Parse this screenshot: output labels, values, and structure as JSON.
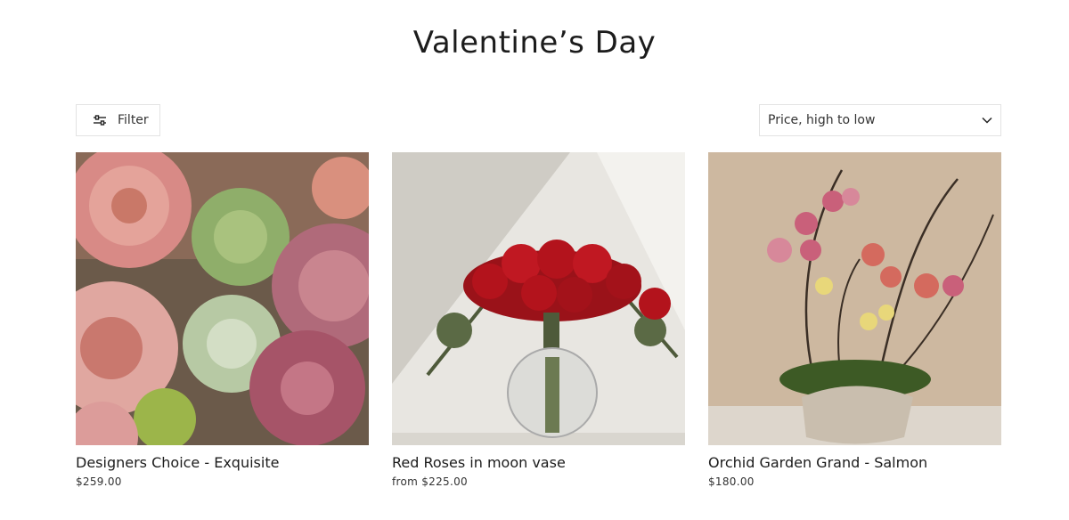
{
  "collection": {
    "title": "Valentine’s Day"
  },
  "toolbar": {
    "filter_label": "Filter",
    "sort_selected": "Price, high to low"
  },
  "products": [
    {
      "name": "Designers Choice - Exquisite",
      "price": "$259.00"
    },
    {
      "name": "Red Roses in moon vase",
      "price": "from $225.00"
    },
    {
      "name": "Orchid Garden Grand - Salmon",
      "price": "$180.00"
    }
  ],
  "colors": {
    "text": "#1c1c1c",
    "border": "#e3e3e3",
    "rose_red": "#b3131c",
    "orchid_pink": "#c9607a"
  }
}
